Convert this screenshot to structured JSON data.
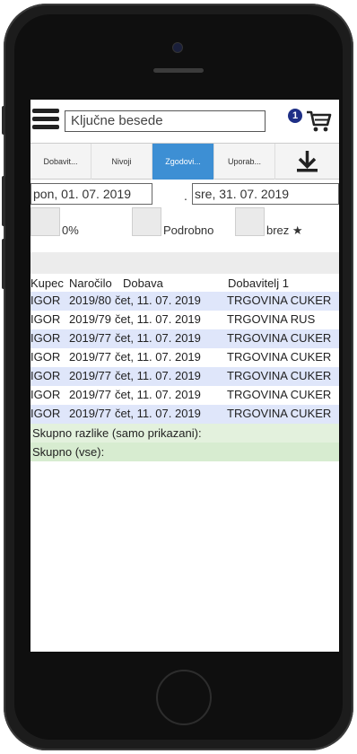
{
  "search": {
    "placeholder": "Ključne besede"
  },
  "cart": {
    "badge": "1"
  },
  "tabs": [
    {
      "label": "Dobavit..."
    },
    {
      "label": "Nivoji"
    },
    {
      "label": "Zgodovi..."
    },
    {
      "label": "Uporab..."
    }
  ],
  "dates": {
    "from": "pon, 01. 07. 2019",
    "separator": ".",
    "to": "sre, 31. 07. 2019"
  },
  "options": [
    {
      "label": "0%"
    },
    {
      "label": "Podrobno"
    },
    {
      "label": "brez ★"
    }
  ],
  "table": {
    "headers": [
      "Kupec",
      "Naročilo",
      "Dobava",
      "Dobavitelj 1"
    ],
    "rows": [
      [
        "IGOR",
        "2019/80",
        "čet, 11. 07. 2019",
        "TRGOVINA CUKER"
      ],
      [
        "IGOR",
        "2019/79",
        "čet, 11. 07. 2019",
        "TRGOVINA RUS"
      ],
      [
        "IGOR",
        "2019/77",
        "čet, 11. 07. 2019",
        "TRGOVINA CUKER"
      ],
      [
        "IGOR",
        "2019/77",
        "čet, 11. 07. 2019",
        "TRGOVINA CUKER"
      ],
      [
        "IGOR",
        "2019/77",
        "čet, 11. 07. 2019",
        "TRGOVINA CUKER"
      ],
      [
        "IGOR",
        "2019/77",
        "čet, 11. 07. 2019",
        "TRGOVINA CUKER"
      ],
      [
        "IGOR",
        "2019/77",
        "čet, 11. 07. 2019",
        "TRGOVINA CUKER"
      ]
    ]
  },
  "summary": {
    "shown": "Skupno razlike (samo prikazani):",
    "all": "Skupno (vse):"
  },
  "colors": {
    "active_tab": "#3d8fd4",
    "row_alt": "#dfe6fa",
    "summary": "#d7ecd0",
    "badge": "#1e2f86"
  }
}
